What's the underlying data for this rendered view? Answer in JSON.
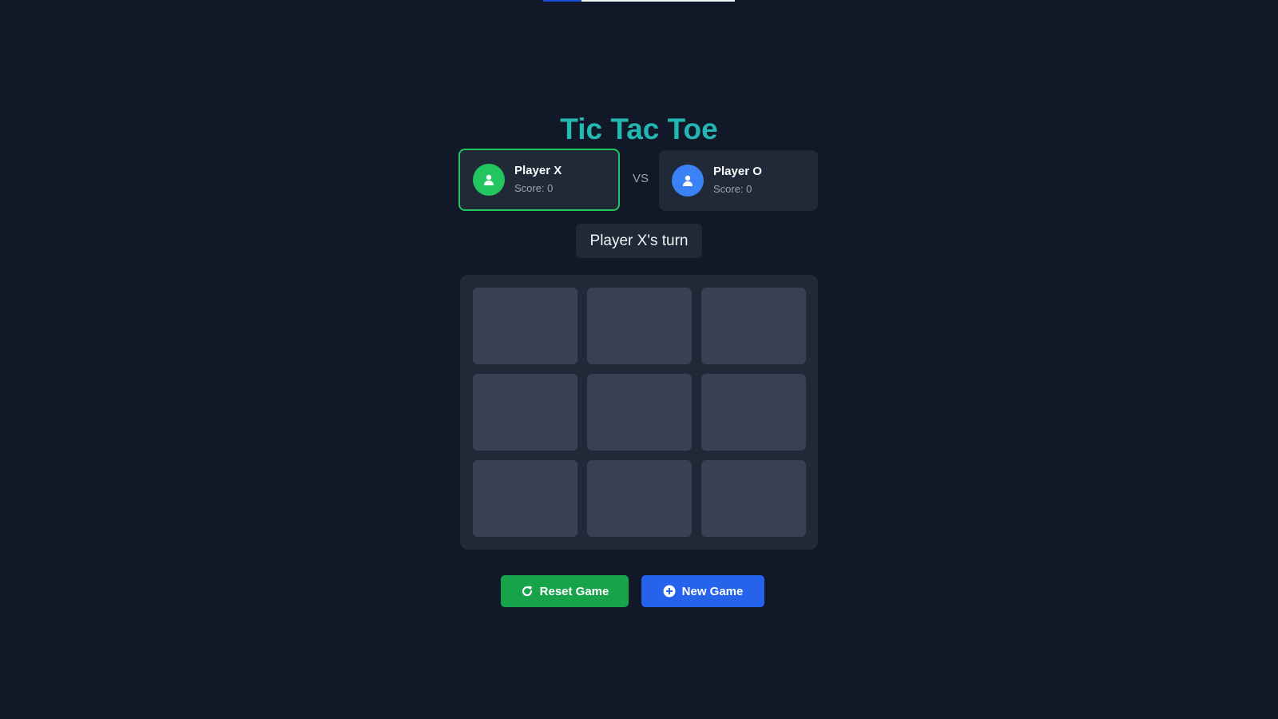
{
  "game": {
    "title": "Tic Tac Toe",
    "vs_label": "VS",
    "turn_text": "Player X's turn",
    "active_player": "X"
  },
  "players": [
    {
      "name": "Player X",
      "score_label": "Score: 0",
      "avatar_icon": "user-icon",
      "color": "#22c55e",
      "active": true
    },
    {
      "name": "Player O",
      "score_label": "Score: 0",
      "avatar_icon": "user-icon",
      "color": "#3b82f6",
      "active": false
    }
  ],
  "board": {
    "cells": [
      "",
      "",
      "",
      "",
      "",
      "",
      "",
      "",
      ""
    ]
  },
  "buttons": {
    "reset_label": "Reset Game",
    "reset_icon": "redo-icon",
    "reset_color": "#16a34a",
    "new_label": "New Game",
    "new_icon": "plus-circle-icon",
    "new_color": "#2563eb"
  },
  "theme": {
    "background": "#111827",
    "panel": "#1f2937",
    "cell": "#374151",
    "title_gradient": [
      "#2dd4bf",
      "#38a3d6"
    ]
  }
}
